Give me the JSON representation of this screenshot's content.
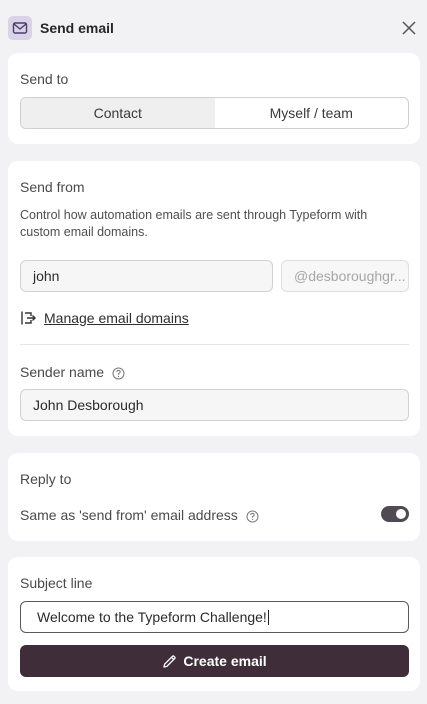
{
  "header": {
    "title": "Send email"
  },
  "send_to": {
    "label": "Send to",
    "options": [
      {
        "label": "Contact",
        "selected": true
      },
      {
        "label": "Myself / team",
        "selected": false
      }
    ]
  },
  "send_from": {
    "label": "Send from",
    "description": "Control how automation emails are sent through Typeform with custom email domains.",
    "username_value": "john",
    "domain_value": "@desboroughgr...",
    "manage_link": "Manage email domains",
    "sender_name_label": "Sender name",
    "sender_name_value": "John Desborough"
  },
  "reply_to": {
    "label": "Reply to",
    "same_as_label": "Same as 'send from' email address",
    "toggle_on": true
  },
  "subject": {
    "label": "Subject line",
    "value": "Welcome to the Typeform Challenge!",
    "create_button": "Create email"
  },
  "colors": {
    "background": "#f2f1f3",
    "primary_button": "#3f2e3a",
    "header_icon_bg": "#d9d3e7",
    "toggle_on": "#4f4a54"
  }
}
